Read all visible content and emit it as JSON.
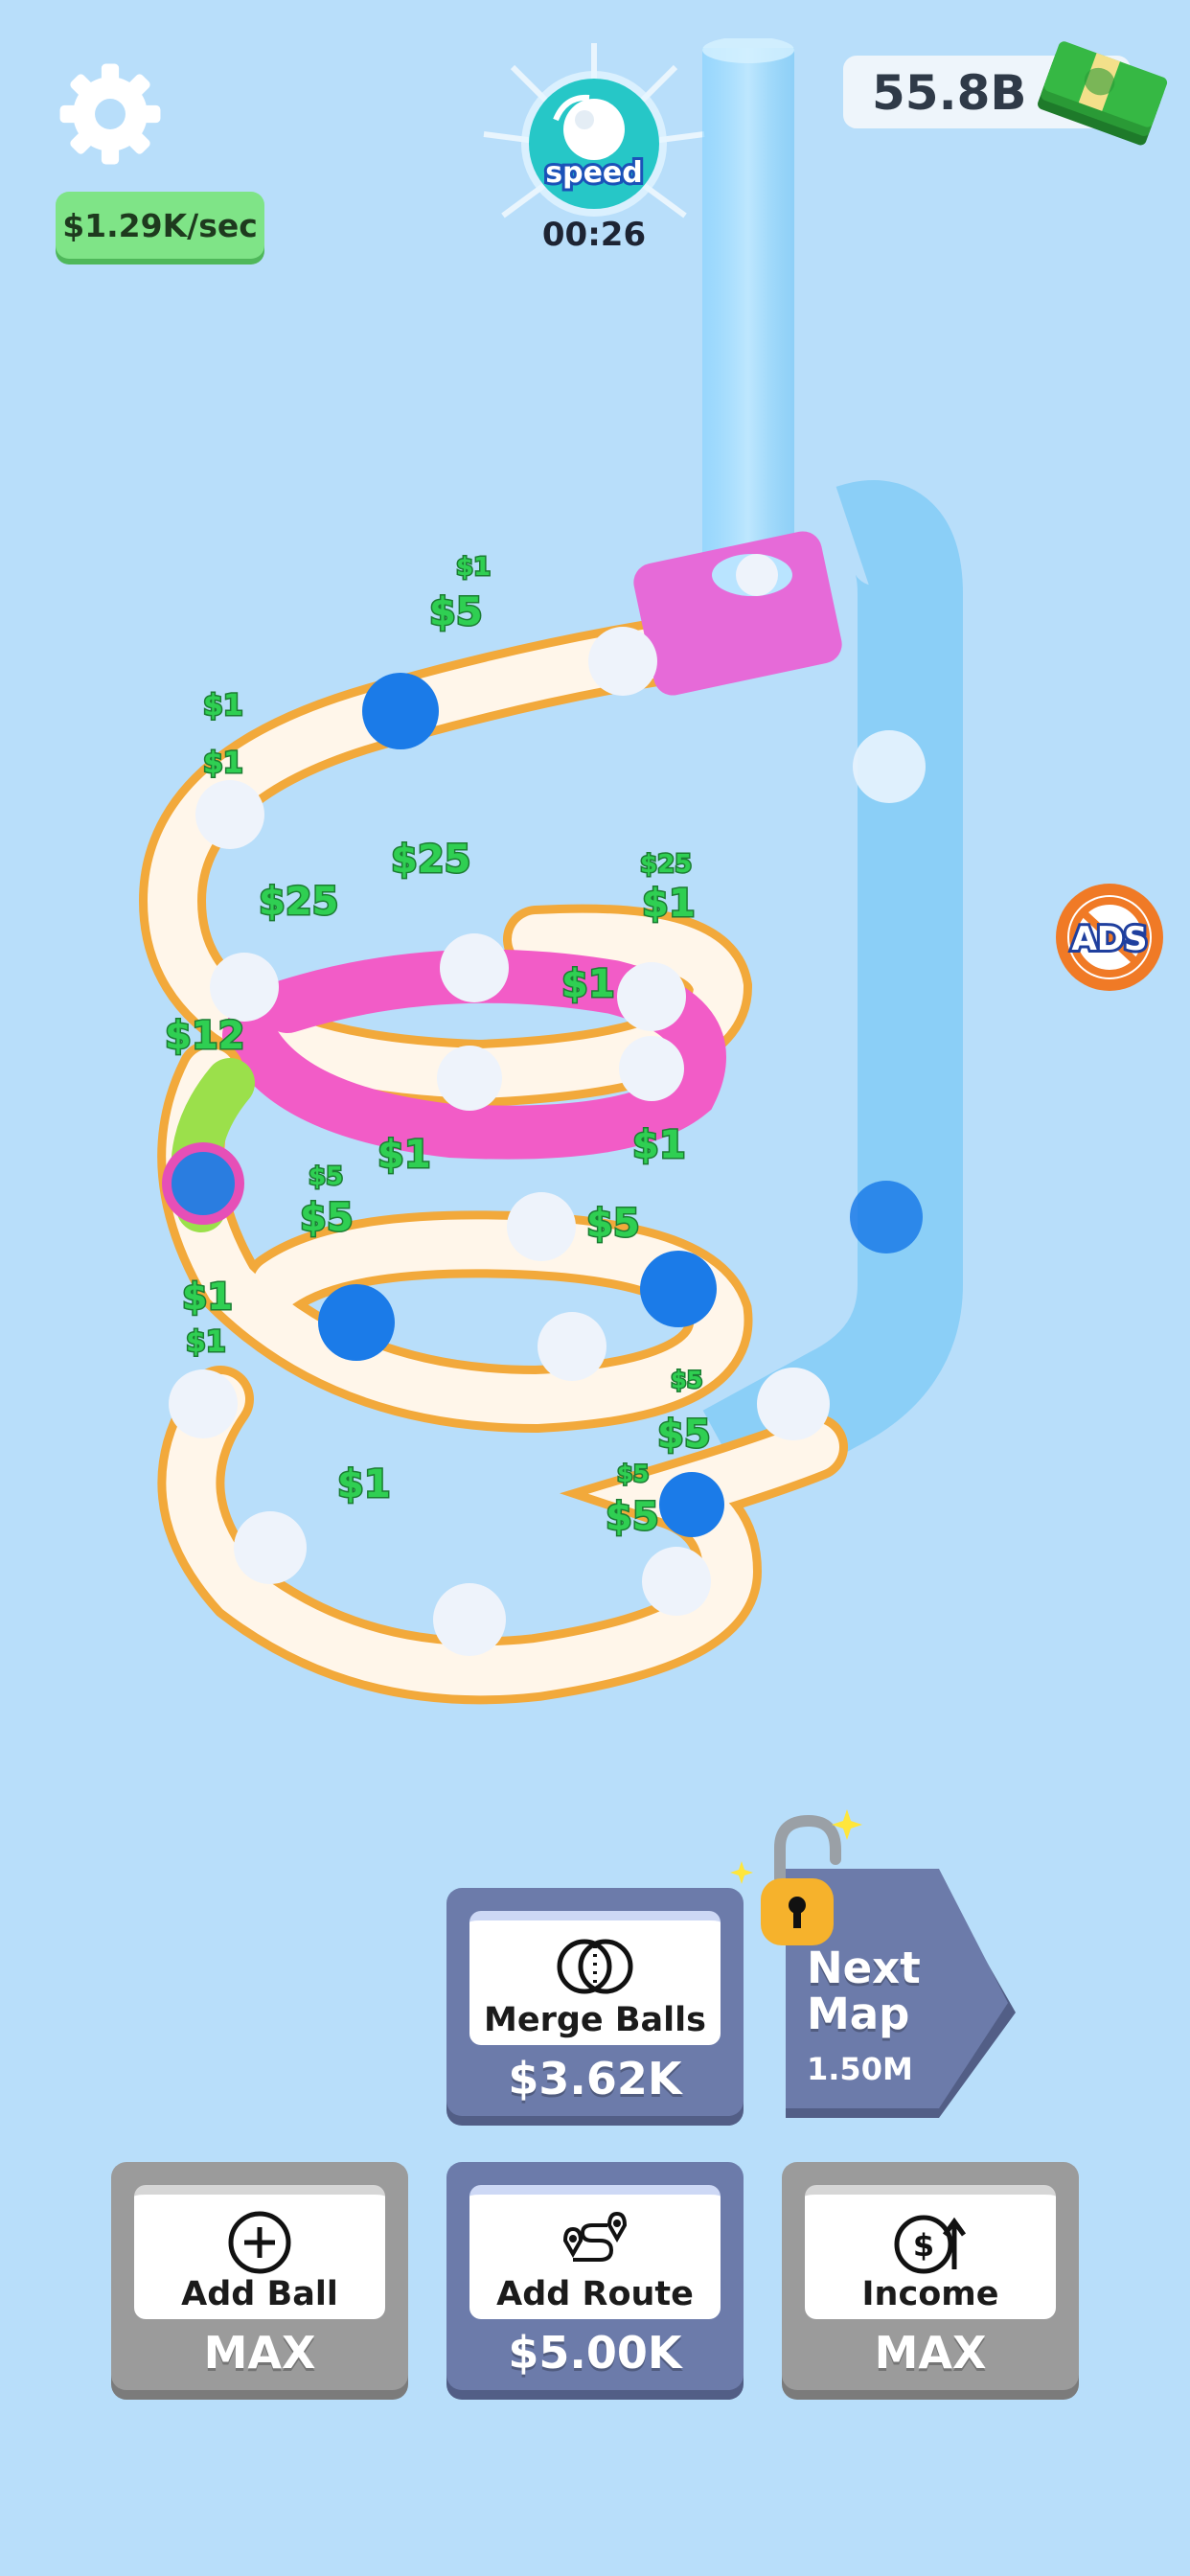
{
  "hud": {
    "income_rate": "$1.29K/sec",
    "money": "55.8B",
    "speed_boost_label": "speed",
    "speed_timer": "00:26",
    "ads_label": "ADS"
  },
  "floating_rewards": [
    "$1",
    "$5",
    "$1",
    "$1",
    "$25",
    "$25",
    "$25",
    "$1",
    "$1",
    "$12",
    "$5",
    "$1",
    "$1",
    "$5",
    "$5",
    "$1",
    "$1",
    "$5",
    "$5",
    "$5",
    "$1",
    "$5"
  ],
  "upgrades": {
    "merge_balls": {
      "label": "Merge Balls",
      "price": "$3.62K"
    },
    "add_ball": {
      "label": "Add Ball",
      "price": "MAX"
    },
    "add_route": {
      "label": "Add Route",
      "price": "$5.00K"
    },
    "income": {
      "label": "Income",
      "price": "MAX"
    },
    "next_map": {
      "label_line1": "Next",
      "label_line2": "Map",
      "price": "1.50M"
    }
  },
  "colors": {
    "background": "#b8defa",
    "track": "#f2a93b",
    "tube": "#6cc4f5",
    "pink_ring": "#f25cc7",
    "green_button": "#7fe487",
    "card_blue": "#6c7baa",
    "card_grey": "#9b9b9b"
  }
}
